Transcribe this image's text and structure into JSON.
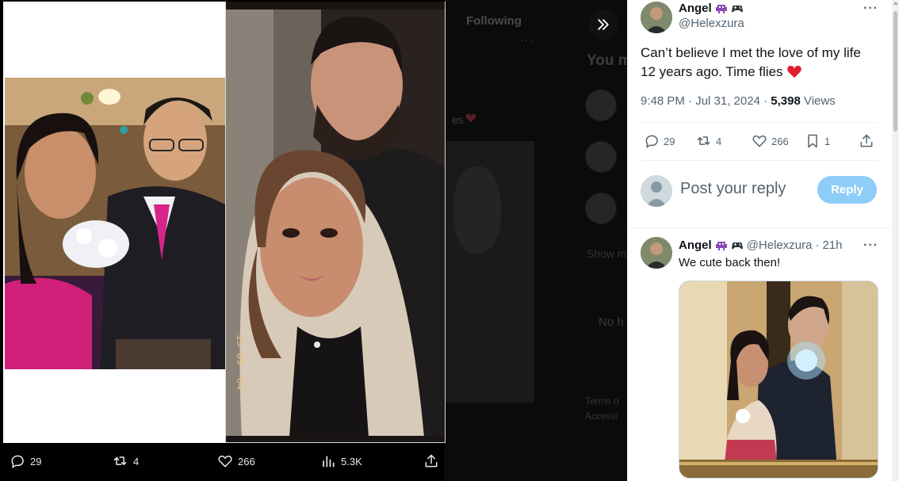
{
  "background": {
    "tab_following": "Following",
    "heading_partial": "You m",
    "text_partial": "es",
    "show_partial": "Show m",
    "no_partial": "No h",
    "footer_line1": "Terms o",
    "footer_line2": "Accessi"
  },
  "media_bar": {
    "reply_count": "29",
    "retweet_count": "4",
    "like_count": "266",
    "views_count": "5.3K"
  },
  "tweet": {
    "author_name": "Angel",
    "author_handle": "@Helexzura",
    "text": "Can’t believe I met the love of my life 12 years ago. Time flies",
    "time": "9:48 PM · Jul 31, 2024 · ",
    "views_count": "5,398",
    "views_label": " Views",
    "reply_count": "29",
    "retweet_count": "4",
    "like_count": "266",
    "bookmark_count": "1"
  },
  "composer": {
    "placeholder": "Post your reply",
    "reply_button": "Reply"
  },
  "reply": {
    "author_name": "Angel",
    "author_handle": "@Helexzura",
    "separator": "·",
    "age": "21h",
    "text": "We cute back then!"
  },
  "colors": {
    "accent": "#1d9bf0",
    "reply_button_disabled": "#8ecdf8",
    "heart": "#f91880"
  }
}
